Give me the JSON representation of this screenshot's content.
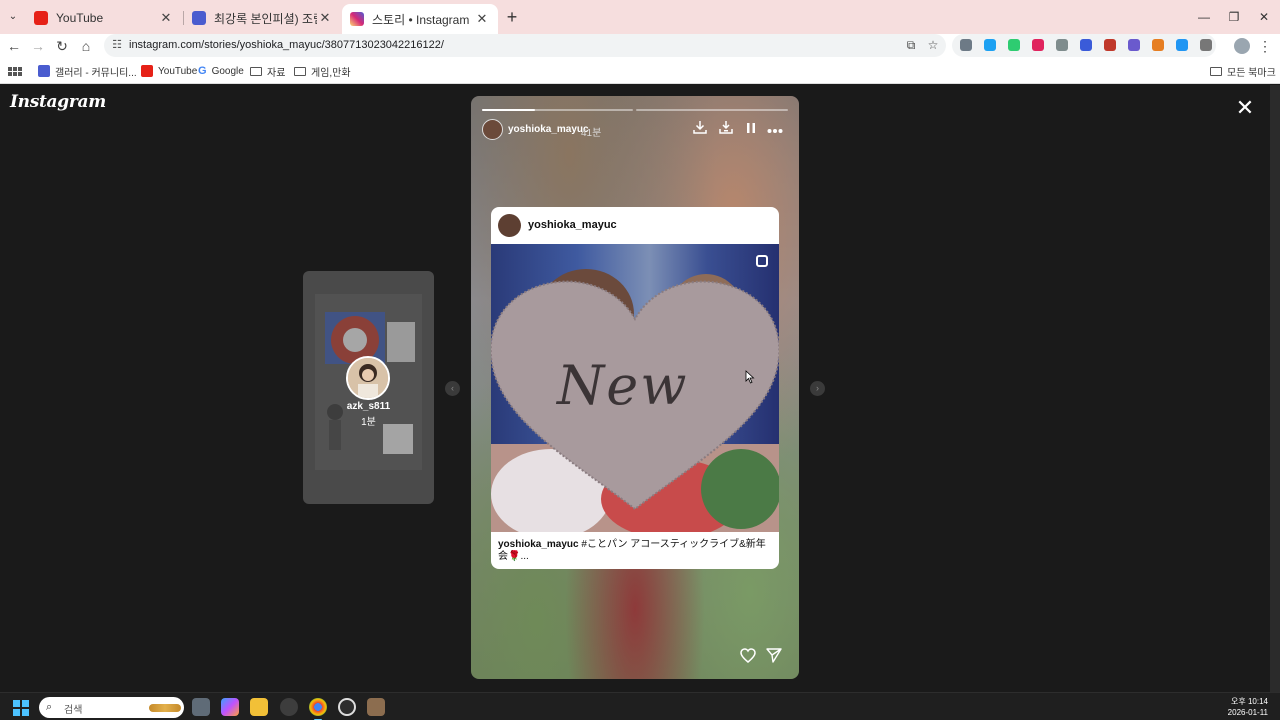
{
  "browser": {
    "tabs": [
      {
        "title": "YouTube",
        "active": false,
        "favicon_color": "#e62117"
      },
      {
        "title": "최강록 본인피셜) 조림중에서",
        "active": false,
        "favicon_color": "#4a5ccf"
      },
      {
        "title": "스토리 • Instagram",
        "active": true,
        "favicon_color": "#d6249f"
      }
    ],
    "new_tab_label": "+",
    "url": "instagram.com/stories/yoshioka_mayuc/3807713023042216122/",
    "bookmarks": [
      {
        "label": "갤러리 - 커뮤니티...",
        "type": "site",
        "color": "#4a5ccf"
      },
      {
        "label": "YouTube",
        "type": "site",
        "color": "#e62117"
      },
      {
        "label": "Google",
        "type": "google",
        "color": "#4285f4"
      },
      {
        "label": "자료",
        "type": "folder"
      },
      {
        "label": "게임,만화",
        "type": "folder"
      }
    ],
    "all_bookmarks_label": "모든 북마크"
  },
  "instagram": {
    "logo_text": "Instagram",
    "previous_story": {
      "username": "azk_s811",
      "time": "1분"
    },
    "story": {
      "username": "yoshioka_mayuc",
      "time": "41분",
      "progress_segments": [
        0.35,
        0,
        0
      ],
      "post": {
        "username": "yoshioka_mayuc",
        "image_text": "New",
        "caption_user": "yoshioka_mayuc",
        "caption_text": " #ことパン アコースティックライブ&新年会🌹..."
      }
    }
  },
  "taskbar": {
    "search_placeholder": "검색",
    "time": "오후 10:14",
    "date": "2026-01-11"
  }
}
